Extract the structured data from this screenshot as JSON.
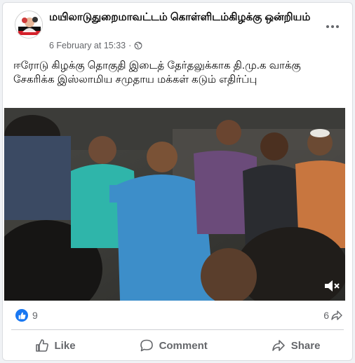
{
  "post": {
    "page_name": "மயிலாடுதுறைமாவட்டம் கொள்ளிடம்கிழக்கு ஒன்றியம்",
    "timestamp": "6 February at 15:33",
    "separator": "·",
    "audience_icon": "globe-icon",
    "text": "ஈரோடு கிழக்கு தொகுதி  இடைத் தேர்தலுக்காக தி.மு.க வாக்கு சேகரிக்க இஸ்லாமிய சமுதாய மக்கள் கடும் எதிர்ப்பு"
  },
  "video": {
    "mute_icon": "muted-speaker-icon"
  },
  "stats": {
    "reaction_icon": "like-reaction-icon",
    "reactions": "9",
    "shares": "6"
  },
  "actions": {
    "like_label": "Like",
    "comment_label": "Comment",
    "share_label": "Share"
  },
  "colors": {
    "accent": "#1877f2",
    "secondary_text": "#65676b",
    "primary_text": "#050505"
  }
}
